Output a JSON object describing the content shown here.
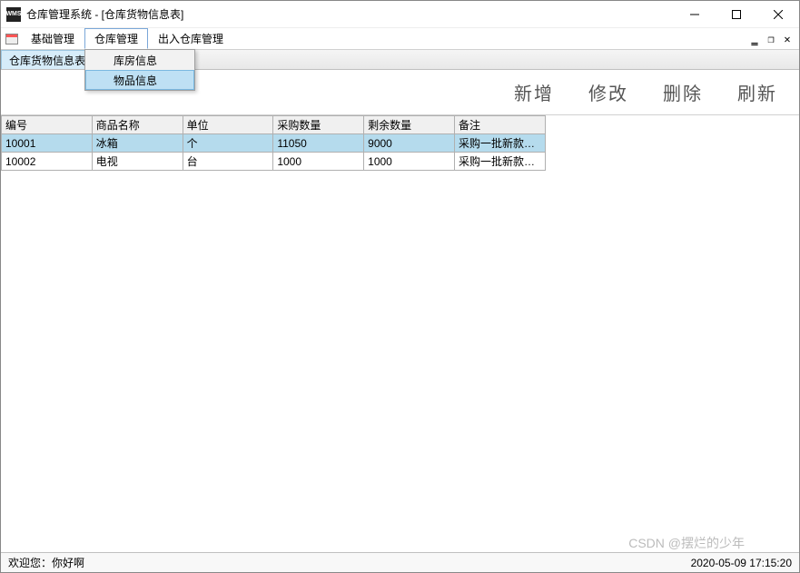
{
  "window": {
    "app_icon_text": "WMS",
    "title": "仓库管理系统 - [仓库货物信息表]"
  },
  "menubar": {
    "items": [
      "基础管理",
      "仓库管理",
      "出入仓库管理"
    ],
    "active_index": 1
  },
  "dropdown": {
    "items": [
      "库房信息",
      "物品信息"
    ],
    "highlight_index": 1
  },
  "subtab": {
    "label": "仓库货物信息表"
  },
  "toolbar": {
    "add": "新增",
    "edit": "修改",
    "delete": "删除",
    "refresh": "刷新"
  },
  "table": {
    "columns": [
      "编号",
      "商品名称",
      "单位",
      "采购数量",
      "剩余数量",
      "备注"
    ],
    "rows": [
      {
        "id": "10001",
        "name": "冰箱",
        "unit": "个",
        "qty": "11050",
        "remain": "9000",
        "note": "采购一批新款…",
        "selected": true
      },
      {
        "id": "10002",
        "name": "电视",
        "unit": "台",
        "qty": "1000",
        "remain": "1000",
        "note": "采购一批新款…",
        "selected": false
      }
    ]
  },
  "statusbar": {
    "welcome": "欢迎您：你好啊",
    "datetime": "2020-05-09 17:15:20"
  },
  "watermark": "CSDN @摆烂的少年"
}
